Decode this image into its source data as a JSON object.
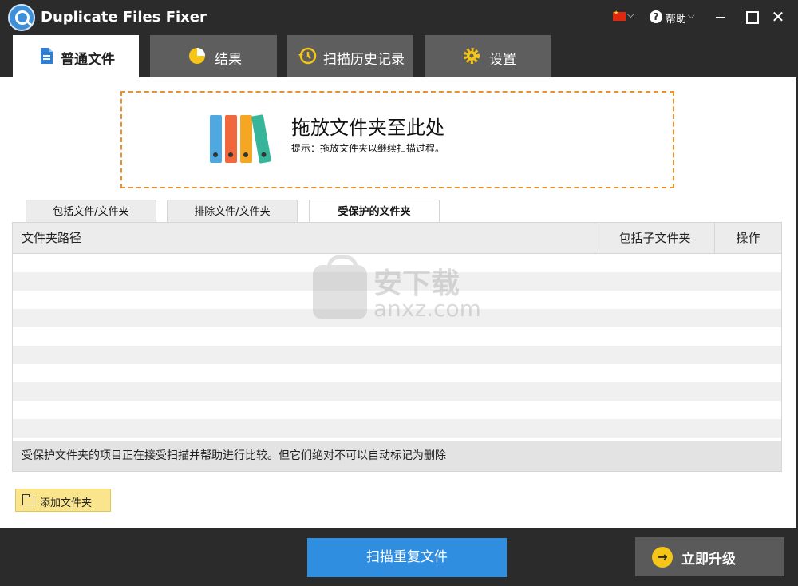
{
  "window": {
    "title": "Duplicate Files Fixer",
    "help_label": "帮助",
    "close_glyph": "✕",
    "caret_glyph": "⌵",
    "help_glyph": "?"
  },
  "tabs": [
    {
      "label": "普通文件",
      "icon": "document-icon",
      "active": true
    },
    {
      "label": "结果",
      "icon": "pie-chart-icon",
      "active": false
    },
    {
      "label": "扫描历史记录",
      "icon": "history-clock-icon",
      "active": false
    },
    {
      "label": "设置",
      "icon": "gear-icon",
      "active": false
    }
  ],
  "dropzone": {
    "title": "拖放文件夹至此处",
    "hint": "提示：拖放文件夹以继续扫描过程。",
    "icon": "binders-icon",
    "binder_colors": [
      "#4fa9e0",
      "#f0683c",
      "#f5a623",
      "#36b59a"
    ]
  },
  "subtabs": [
    {
      "label": "包括文件/文件夹",
      "active": false
    },
    {
      "label": "排除文件/文件夹",
      "active": false
    },
    {
      "label": "受保护的文件夹",
      "active": true
    }
  ],
  "table": {
    "columns": [
      "文件夹路径",
      "包括子文件夹",
      "操作"
    ],
    "footer": "受保护文件夹的项目正在接受扫描并帮助进行比较。但它们绝对不可以自动标记为删除"
  },
  "watermark": {
    "cn": "安下载",
    "en": "anxz.com"
  },
  "buttons": {
    "add_folder": "添加文件夹",
    "scan": "扫描重复文件",
    "upgrade": "立即升级",
    "upgrade_arrow": "→"
  },
  "colors": {
    "accent_blue": "#2f8ee0",
    "dropzone_border": "#e8912d",
    "add_button": "#fbe58c",
    "upgrade_arrow": "#f5c518"
  }
}
